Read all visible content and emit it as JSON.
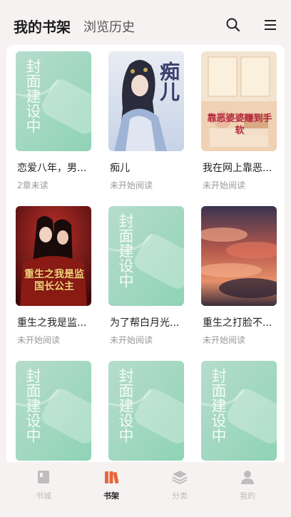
{
  "header": {
    "active_tab": "我的书架",
    "history_tab": "浏览历史",
    "search_icon": "search-icon",
    "menu_icon": "menu-icon"
  },
  "placeholder": {
    "text": "封面建设中",
    "colors": [
      "#a9d9c8",
      "#8fd0b6",
      "#c4e6da"
    ]
  },
  "books": [
    {
      "title": "恋爱八年，男...",
      "status": "2章未读",
      "cover": "placeholder"
    },
    {
      "title": "痴儿",
      "status": "未开始阅读",
      "cover": "ancient-girl",
      "cover_text": "痴儿"
    },
    {
      "title": "我在网上靠恶...",
      "status": "未开始阅读",
      "cover": "warm-room",
      "cover_text": "靠恶婆婆赚到手软"
    },
    {
      "title": "重生之我是监...",
      "status": "未开始阅读",
      "cover": "red-palace",
      "cover_text": "重生之我是监国长公主"
    },
    {
      "title": "为了帮白月光...",
      "status": "未开始阅读",
      "cover": "placeholder"
    },
    {
      "title": "重生之打脸不...",
      "status": "未开始阅读",
      "cover": "sunset-clouds"
    },
    {
      "title": "",
      "status": "",
      "cover": "placeholder"
    },
    {
      "title": "",
      "status": "",
      "cover": "placeholder"
    },
    {
      "title": "",
      "status": "",
      "cover": "placeholder"
    }
  ],
  "bottom_nav": [
    {
      "label": "书城",
      "icon": "book-city-icon",
      "active": false
    },
    {
      "label": "书架",
      "icon": "bookshelf-icon",
      "active": true
    },
    {
      "label": "分类",
      "icon": "category-layers-icon",
      "active": false
    },
    {
      "label": "我的",
      "icon": "profile-icon",
      "active": false
    }
  ],
  "colors": {
    "background": "#f5f2f1",
    "active_accent": "#e8663c",
    "inactive_nav": "#bdbdbd",
    "status_text": "#999999"
  }
}
